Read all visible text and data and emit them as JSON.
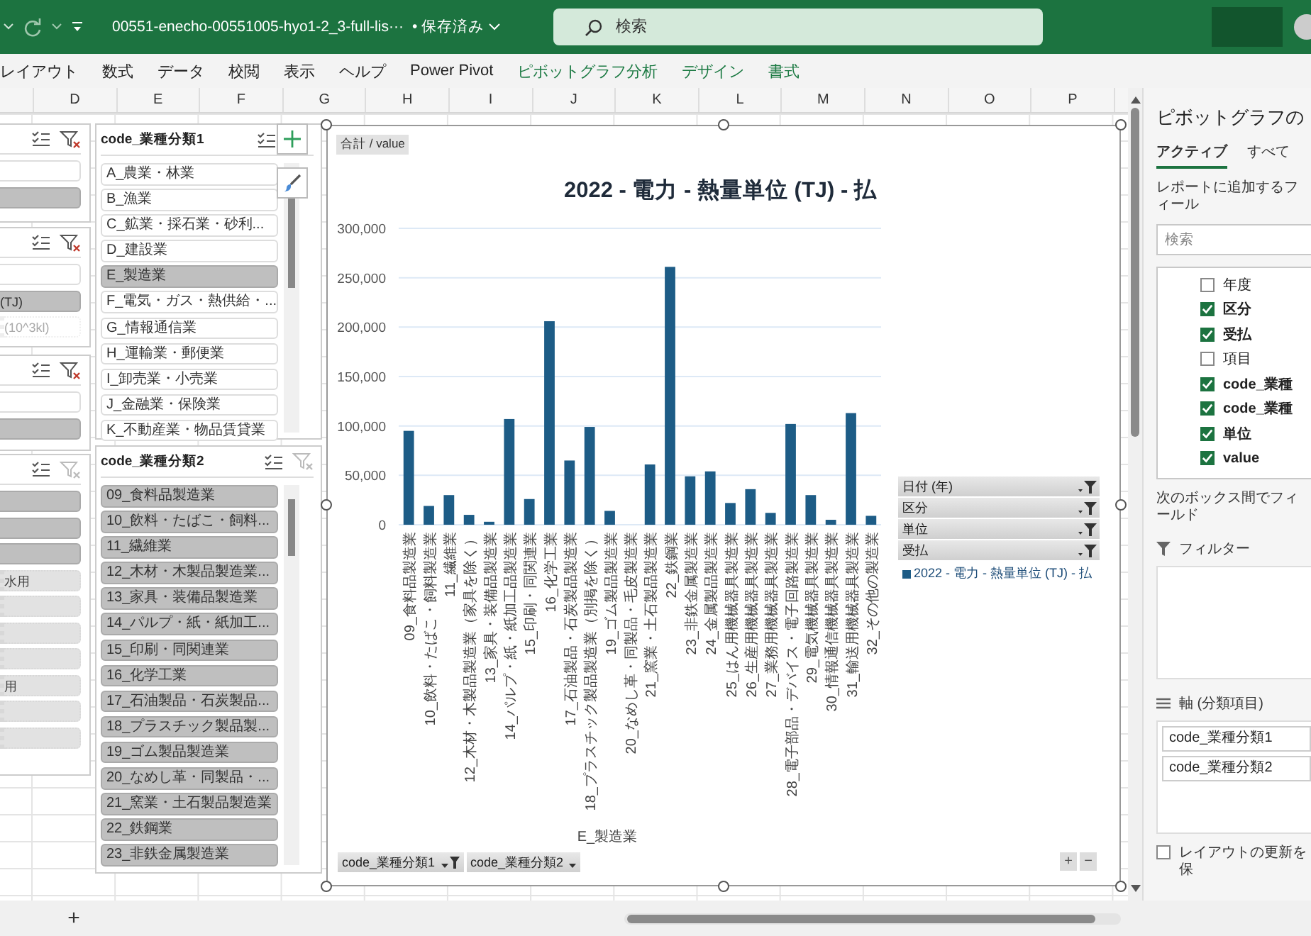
{
  "title_bar": {
    "filename": "00551-enecho-00551005-hyo1-2_3-full-lis···",
    "save_status": "• 保存済み",
    "search": {
      "placeholder": "検索"
    }
  },
  "ribbon": {
    "tabs": [
      {
        "label": "レイアウト",
        "kind": "standard"
      },
      {
        "label": "数式",
        "kind": "standard"
      },
      {
        "label": "データ",
        "kind": "standard"
      },
      {
        "label": "校閲",
        "kind": "standard"
      },
      {
        "label": "表示",
        "kind": "standard"
      },
      {
        "label": "ヘルプ",
        "kind": "standard"
      },
      {
        "label": "Power Pivot",
        "kind": "standard"
      },
      {
        "label": "ピボットグラフ分析",
        "kind": "contextual"
      },
      {
        "label": "デザイン",
        "kind": "contextual"
      },
      {
        "label": "書式",
        "kind": "contextual"
      }
    ]
  },
  "sheet": {
    "columns": [
      "D",
      "E",
      "F",
      "G",
      "H",
      "I",
      "J",
      "K",
      "L",
      "M",
      "N",
      "O",
      "P"
    ],
    "cut_slicers": [
      {
        "clear_enabled": true,
        "items": [
          {
            "selected": false,
            "available": true
          },
          {
            "selected": true,
            "available": true
          }
        ]
      },
      {
        "clear_enabled": true,
        "items": [
          {
            "selected": false,
            "available": true
          },
          {
            "label": "(TJ)",
            "selected": true,
            "available": true
          },
          {
            "label": "(10^3kl)",
            "selected": false,
            "available": false
          }
        ]
      },
      {
        "clear_enabled": true,
        "items": [
          {
            "selected": false,
            "available": true
          },
          {
            "selected": true,
            "available": true
          }
        ]
      },
      {
        "clear_enabled": false,
        "items": [
          {
            "selected": true,
            "available": true
          },
          {
            "selected": true,
            "available": true
          },
          {
            "selected": true,
            "available": true
          },
          {
            "label": "水用",
            "selected": true,
            "available": false
          },
          {
            "selected": true,
            "available": false
          },
          {
            "selected": true,
            "available": false
          },
          {
            "selected": true,
            "available": false
          },
          {
            "label": "用",
            "selected": true,
            "available": false
          },
          {
            "selected": true,
            "available": false
          },
          {
            "selected": true,
            "available": false
          }
        ]
      }
    ],
    "slicers": [
      {
        "title": "code_業種分類1",
        "items": [
          {
            "label": "A_農業・林業",
            "selected": false,
            "available": true
          },
          {
            "label": "B_漁業",
            "selected": false,
            "available": true
          },
          {
            "label": "C_鉱業・採石業・砂利...",
            "selected": false,
            "available": true
          },
          {
            "label": "D_建設業",
            "selected": false,
            "available": true
          },
          {
            "label": "E_製造業",
            "selected": true,
            "available": true
          },
          {
            "label": "F_電気・ガス・熱供給・...",
            "selected": false,
            "available": true
          },
          {
            "label": "G_情報通信業",
            "selected": false,
            "available": true
          },
          {
            "label": "H_運輸業・郵便業",
            "selected": false,
            "available": true
          },
          {
            "label": "I_卸売業・小売業",
            "selected": false,
            "available": true
          },
          {
            "label": "J_金融業・保険業",
            "selected": false,
            "available": true
          },
          {
            "label": "K_不動産業・物品賃貸業",
            "selected": false,
            "available": true
          }
        ]
      },
      {
        "title": "code_業種分類2",
        "clear_enabled": false,
        "items": [
          {
            "label": "09_食料品製造業",
            "selected": true,
            "available": true
          },
          {
            "label": "10_飲料・たばこ・飼料...",
            "selected": true,
            "available": true
          },
          {
            "label": "11_繊維業",
            "selected": true,
            "available": true
          },
          {
            "label": "12_木材・木製品製造業...",
            "selected": true,
            "available": true
          },
          {
            "label": "13_家具・装備品製造業",
            "selected": true,
            "available": true
          },
          {
            "label": "14_パルプ・紙・紙加工...",
            "selected": true,
            "available": true
          },
          {
            "label": "15_印刷・同関連業",
            "selected": true,
            "available": true
          },
          {
            "label": "16_化学工業",
            "selected": true,
            "available": true
          },
          {
            "label": "17_石油製品・石炭製品...",
            "selected": true,
            "available": true
          },
          {
            "label": "18_プラスチック製品製...",
            "selected": true,
            "available": true
          },
          {
            "label": "19_ゴム製品製造業",
            "selected": true,
            "available": true
          },
          {
            "label": "20_なめし革・同製品・...",
            "selected": true,
            "available": true
          },
          {
            "label": "21_窯業・土石製品製造業",
            "selected": true,
            "available": true
          },
          {
            "label": "22_鉄鋼業",
            "selected": true,
            "available": true
          },
          {
            "label": "23_非鉄金属製造業",
            "selected": true,
            "available": true
          }
        ]
      }
    ]
  },
  "chart": {
    "value_button": "合計 / value",
    "chart_data": {
      "type": "bar",
      "title": "2022 - 電力 - 熱量単位 (TJ) - 払",
      "xlabel": "E_製造業",
      "categories": [
        "09_食料品製造業",
        "10_飲料・たばこ・飼料製造業",
        "11_繊維業",
        "12_木材・木製品製造業（家具を除く）",
        "13_家具・装備品製造業",
        "14_パルプ・紙・紙加工品製造業",
        "15_印刷・同関連業",
        "16_化学工業",
        "17_石油製品・石炭製品製造業",
        "18_プラスチック製品製造業（別掲を除く）",
        "19_ゴム製品製造業",
        "20_なめし革・同製品・毛皮製造業",
        "21_窯業・土石製品製造業",
        "22_鉄鋼業",
        "23_非鉄金属製造業",
        "24_金属製品製造業",
        "25_はん用機械器具製造業",
        "26_生産用機械器具製造業",
        "27_業務用機械器具製造業",
        "28_電子部品・デバイス・電子回路製造業",
        "29_電気機械器具製造業",
        "30_情報通信機械器具製造業",
        "31_輸送用機械器具製造業",
        "32_その他の製造業"
      ],
      "series": [
        {
          "name": "2022 - 電力 - 熱量単位 (TJ) - 払",
          "color": "#1d5c86",
          "values": [
            95000,
            19000,
            30000,
            10000,
            3000,
            107000,
            26000,
            206000,
            65000,
            99000,
            14000,
            0,
            61000,
            261000,
            49000,
            54000,
            22000,
            36000,
            12000,
            102000,
            30000,
            5000,
            113000,
            9000
          ]
        }
      ],
      "grid": true,
      "ylim": [
        0,
        300000
      ],
      "yticks": [
        {
          "value": 0,
          "label": "0"
        },
        {
          "value": 50000,
          "label": "50,000"
        },
        {
          "value": 100000,
          "label": "100,000"
        },
        {
          "value": 150000,
          "label": "150,000"
        },
        {
          "value": 200000,
          "label": "200,000"
        },
        {
          "value": 250000,
          "label": "250,000"
        },
        {
          "value": 300000,
          "label": "300,000"
        }
      ]
    },
    "legend_fields": [
      {
        "label": "日付 (年)",
        "filtered": true
      },
      {
        "label": "区分",
        "filtered": true
      },
      {
        "label": "単位",
        "filtered": true
      },
      {
        "label": "受払",
        "filtered": true
      }
    ],
    "axis_fields": [
      {
        "label": "code_業種分類1",
        "filtered": true
      },
      {
        "label": "code_業種分類2",
        "filtered": false
      }
    ],
    "zoom_buttons": [
      "+",
      "−"
    ]
  },
  "pane": {
    "title": "ピボットグラフの",
    "tabs": [
      {
        "label": "アクティブ",
        "selected": true
      },
      {
        "label": "すべて",
        "selected": false
      }
    ],
    "prompt": "レポートに追加するフィール",
    "search": {
      "placeholder": "検索"
    },
    "fields": [
      {
        "label": "年度",
        "checked": false
      },
      {
        "label": "区分",
        "checked": true
      },
      {
        "label": "受払",
        "checked": true
      },
      {
        "label": "項目",
        "checked": false
      },
      {
        "label": "code_業種",
        "checked": true
      },
      {
        "label": "code_業種",
        "checked": true
      },
      {
        "label": "単位",
        "checked": true
      },
      {
        "label": "value",
        "checked": true
      }
    ],
    "areas_prompt": "次のボックス間でフィールド",
    "filter_label": "フィルター",
    "axis_label": "軸 (分類項目)",
    "axis_items": [
      "code_業種分類1",
      "code_業種分類2"
    ],
    "defer_update": {
      "label": "レイアウトの更新を保",
      "checked": false
    }
  },
  "bottom_bar": {
    "add_sheet": "+"
  }
}
